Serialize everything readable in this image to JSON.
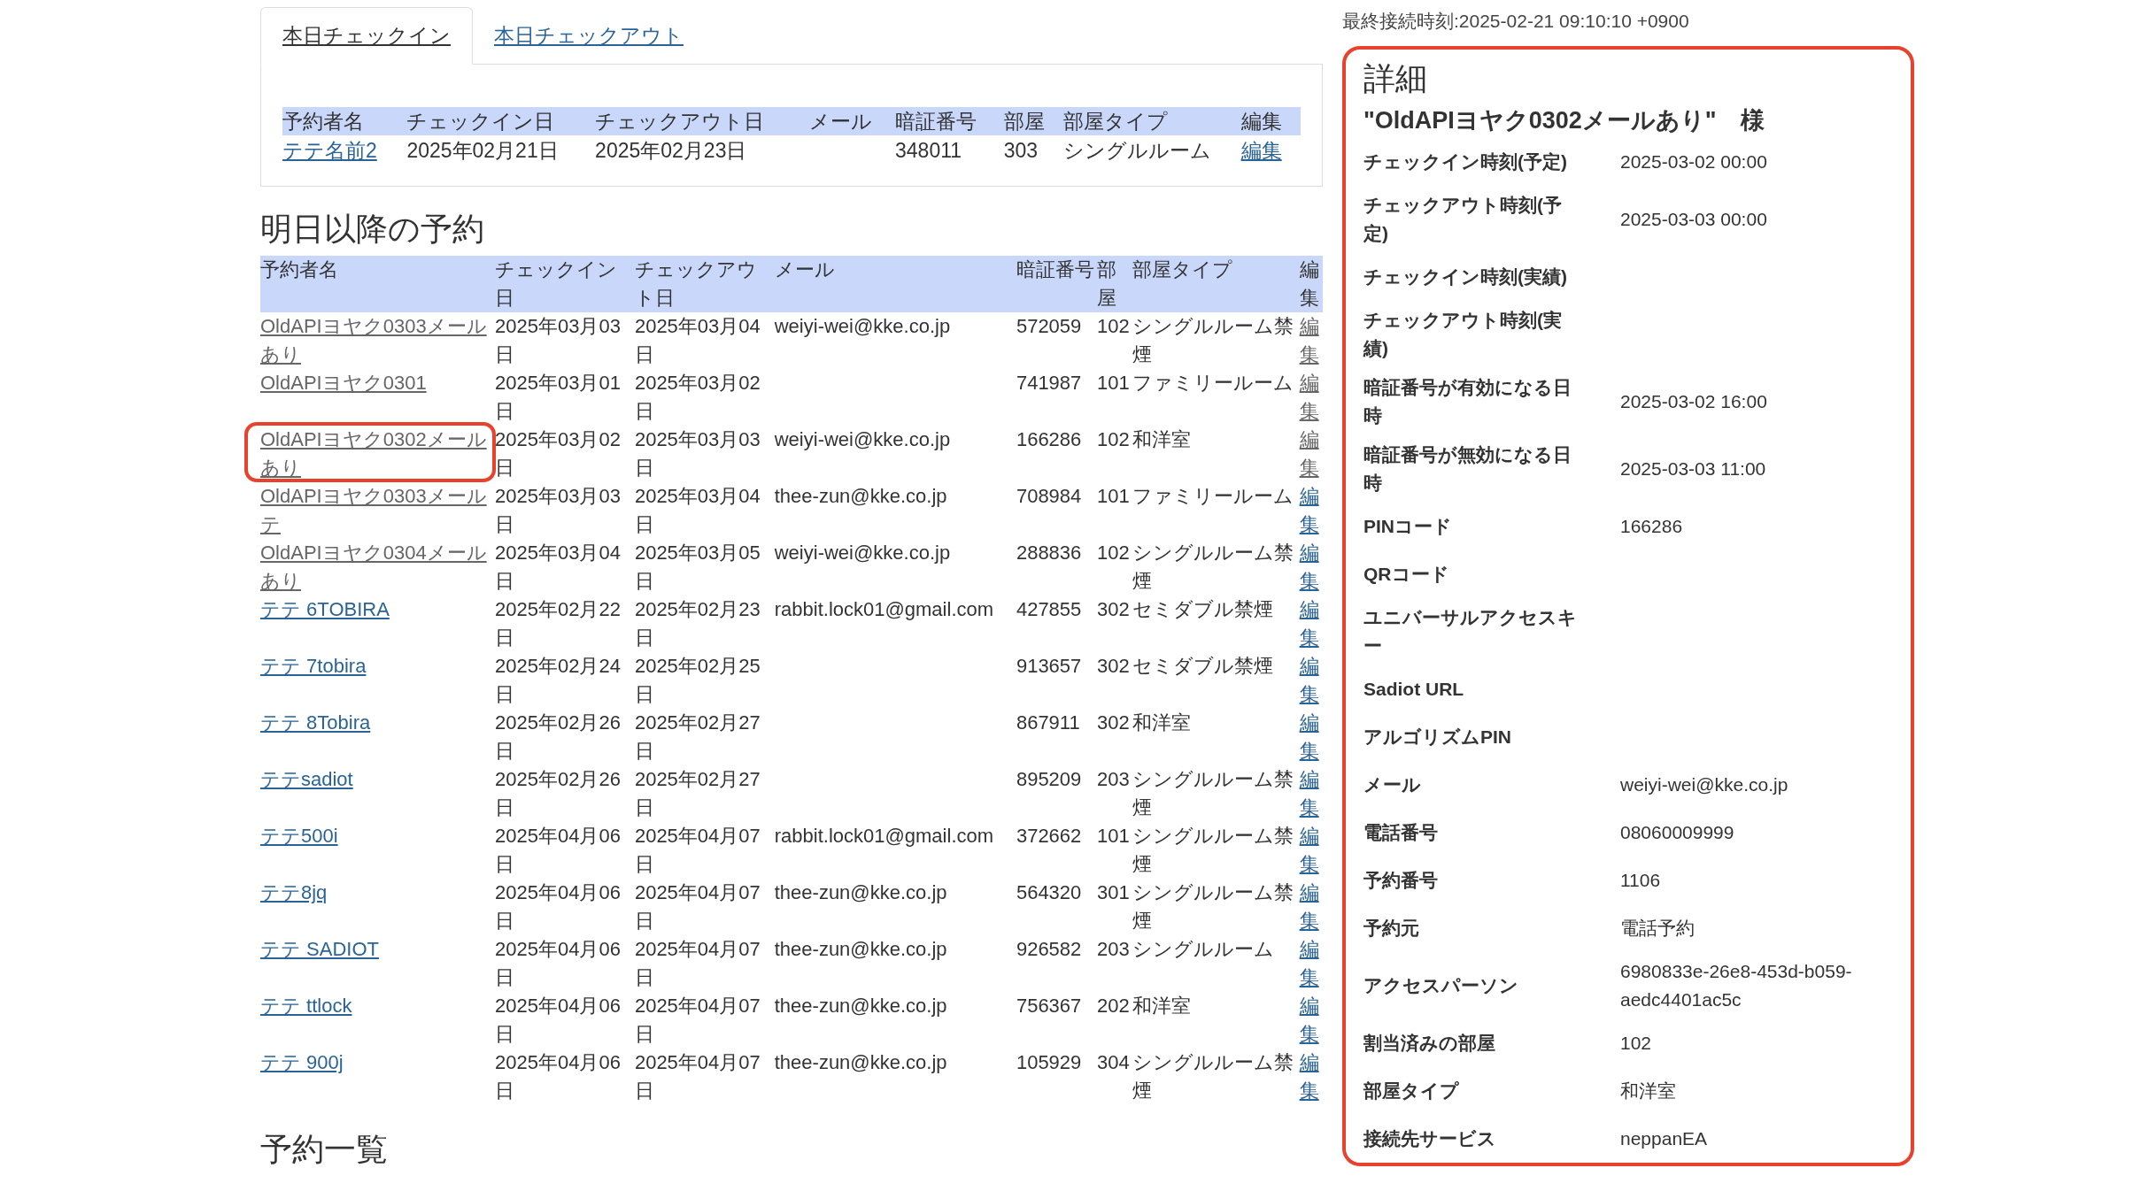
{
  "tabs": [
    {
      "label": "本日チェックイン",
      "selected": true
    },
    {
      "label": "本日チェックアウト",
      "selected": false
    }
  ],
  "today_table": {
    "columns": [
      "予約者名",
      "チェックイン日",
      "チェックアウト日",
      "メール",
      "暗証番号",
      "部屋",
      "部屋タイプ",
      "編集"
    ],
    "rows": [
      {
        "name": "テテ名前2",
        "checkin": "2025年02月21日",
        "checkout": "2025年02月23日",
        "pin": "348011",
        "room": "303",
        "room_type": "シングルルーム",
        "edit": "編集"
      }
    ]
  },
  "upcoming": {
    "heading": "明日以降の予約",
    "columns": [
      "予約者名",
      "チェックイン日",
      "チェックアウト日",
      "メール",
      "暗証番号",
      "部屋",
      "部屋タイプ",
      "編集"
    ],
    "rows": [
      {
        "name": "OldAPIヨヤク0303メールあり",
        "visited": true,
        "highlighted": false,
        "checkin": "2025年03月03日",
        "checkout": "2025年03月04日",
        "mail": "weiyi-wei@kke.co.jp",
        "pin": "572059",
        "room": "102",
        "room_type": "シングルルーム禁煙",
        "edit": "編集",
        "edit_visited": true
      },
      {
        "name": "OldAPIヨヤク0301",
        "visited": true,
        "highlighted": false,
        "checkin": "2025年03月01日",
        "checkout": "2025年03月02日",
        "pin": "741987",
        "room": "101",
        "room_type": "ファミリールーム",
        "edit": "編集",
        "edit_visited": true
      },
      {
        "name": "OldAPIヨヤク0302メールあり",
        "visited": true,
        "highlighted": true,
        "checkin": "2025年03月02日",
        "checkout": "2025年03月03日",
        "mail": "weiyi-wei@kke.co.jp",
        "pin": "166286",
        "room": "102",
        "room_type": "和洋室",
        "edit": "編集",
        "edit_visited": true
      },
      {
        "name": "OldAPIヨヤク0303メールテ",
        "visited": true,
        "highlighted": false,
        "checkin": "2025年03月03日",
        "checkout": "2025年03月04日",
        "mail": "thee-zun@kke.co.jp",
        "pin": "708984",
        "room": "101",
        "room_type": "ファミリールーム",
        "edit": "編集",
        "edit_visited": false
      },
      {
        "name": "OldAPIヨヤク0304メールあり",
        "visited": true,
        "highlighted": false,
        "checkin": "2025年03月04日",
        "checkout": "2025年03月05日",
        "mail": "weiyi-wei@kke.co.jp",
        "pin": "288836",
        "room": "102",
        "room_type": "シングルルーム禁煙",
        "edit": "編集",
        "edit_visited": false
      },
      {
        "name": "テテ 6TOBIRA",
        "visited": false,
        "highlighted": false,
        "checkin": "2025年02月22日",
        "checkout": "2025年02月23日",
        "mail": "rabbit.lock01@gmail.com",
        "pin": "427855",
        "room": "302",
        "room_type": "セミダブル禁煙",
        "edit": "編集",
        "edit_visited": false
      },
      {
        "name": "テテ 7tobira",
        "visited": false,
        "highlighted": false,
        "checkin": "2025年02月24日",
        "checkout": "2025年02月25日",
        "pin": "913657",
        "room": "302",
        "room_type": "セミダブル禁煙",
        "edit": "編集",
        "edit_visited": false
      },
      {
        "name": "テテ 8Tobira",
        "visited": false,
        "highlighted": false,
        "checkin": "2025年02月26日",
        "checkout": "2025年02月27日",
        "pin": "867911",
        "room": "302",
        "room_type": "和洋室",
        "edit": "編集",
        "edit_visited": false
      },
      {
        "name": "テテsadiot",
        "visited": false,
        "highlighted": false,
        "checkin": "2025年02月26日",
        "checkout": "2025年02月27日",
        "pin": "895209",
        "room": "203",
        "room_type": "シングルルーム禁煙",
        "edit": "編集",
        "edit_visited": false
      },
      {
        "name": "テテ500i",
        "visited": false,
        "highlighted": false,
        "checkin": "2025年04月06日",
        "checkout": "2025年04月07日",
        "mail": "rabbit.lock01@gmail.com",
        "pin": "372662",
        "room": "101",
        "room_type": "シングルルーム禁煙",
        "edit": "編集",
        "edit_visited": false
      },
      {
        "name": "テテ8jq",
        "visited": false,
        "highlighted": false,
        "checkin": "2025年04月06日",
        "checkout": "2025年04月07日",
        "mail": "thee-zun@kke.co.jp",
        "pin": "564320",
        "room": "301",
        "room_type": "シングルルーム禁煙",
        "edit": "編集",
        "edit_visited": false
      },
      {
        "name": "テテ SADIOT",
        "visited": false,
        "highlighted": false,
        "checkin": "2025年04月06日",
        "checkout": "2025年04月07日",
        "mail": "thee-zun@kke.co.jp",
        "pin": "926582",
        "room": "203",
        "room_type": "シングルルーム",
        "edit": "編集",
        "edit_visited": false
      },
      {
        "name": "テテ ttlock",
        "visited": false,
        "highlighted": false,
        "checkin": "2025年04月06日",
        "checkout": "2025年04月07日",
        "mail": "thee-zun@kke.co.jp",
        "pin": "756367",
        "room": "202",
        "room_type": "和洋室",
        "edit": "編集",
        "edit_visited": false
      },
      {
        "name": "テテ 900j",
        "visited": false,
        "highlighted": false,
        "checkin": "2025年04月06日",
        "checkout": "2025年04月07日",
        "mail": "thee-zun@kke.co.jp",
        "pin": "105929",
        "room": "304",
        "room_type": "シングルルーム禁煙",
        "edit": "編集",
        "edit_visited": false
      }
    ]
  },
  "list_heading": "予約一覧",
  "last_connection": "最終接続時刻:2025-02-21 09:10:10 +0900",
  "detail": {
    "title": "詳細",
    "guest": "\"OldAPIヨヤク0302メールあり\"　様",
    "fields": [
      {
        "label": "チェックイン時刻(予定)",
        "value": "2025-03-02 00:00"
      },
      {
        "label": "チェックアウト時刻(予定)",
        "value": "2025-03-03 00:00"
      },
      {
        "label": "チェックイン時刻(実績)"
      },
      {
        "label": "チェックアウト時刻(実績)"
      },
      {
        "label": "暗証番号が有効になる日時",
        "value": "2025-03-02 16:00"
      },
      {
        "label": "暗証番号が無効になる日時",
        "value": "2025-03-03 11:00"
      },
      {
        "label": "PINコード",
        "value": "166286"
      },
      {
        "label": "QRコード"
      },
      {
        "label": "ユニバーサルアクセスキー"
      },
      {
        "label": "Sadiot URL"
      },
      {
        "label": "アルゴリズムPIN"
      },
      {
        "label": "メール",
        "value": "weiyi-wei@kke.co.jp"
      },
      {
        "label": "電話番号",
        "value": "08060009999"
      },
      {
        "label": "予約番号",
        "value": "1106"
      },
      {
        "label": "予約元",
        "value": "電話予約"
      },
      {
        "label": "アクセスパーソン",
        "value": "6980833e-26e8-453d-b059-aedc4401ac5c"
      },
      {
        "label": "割当済みの部屋",
        "value": "102"
      },
      {
        "label": "部屋タイプ",
        "value": "和洋室"
      },
      {
        "label": "接続先サービス",
        "value": "neppanEA"
      }
    ]
  }
}
